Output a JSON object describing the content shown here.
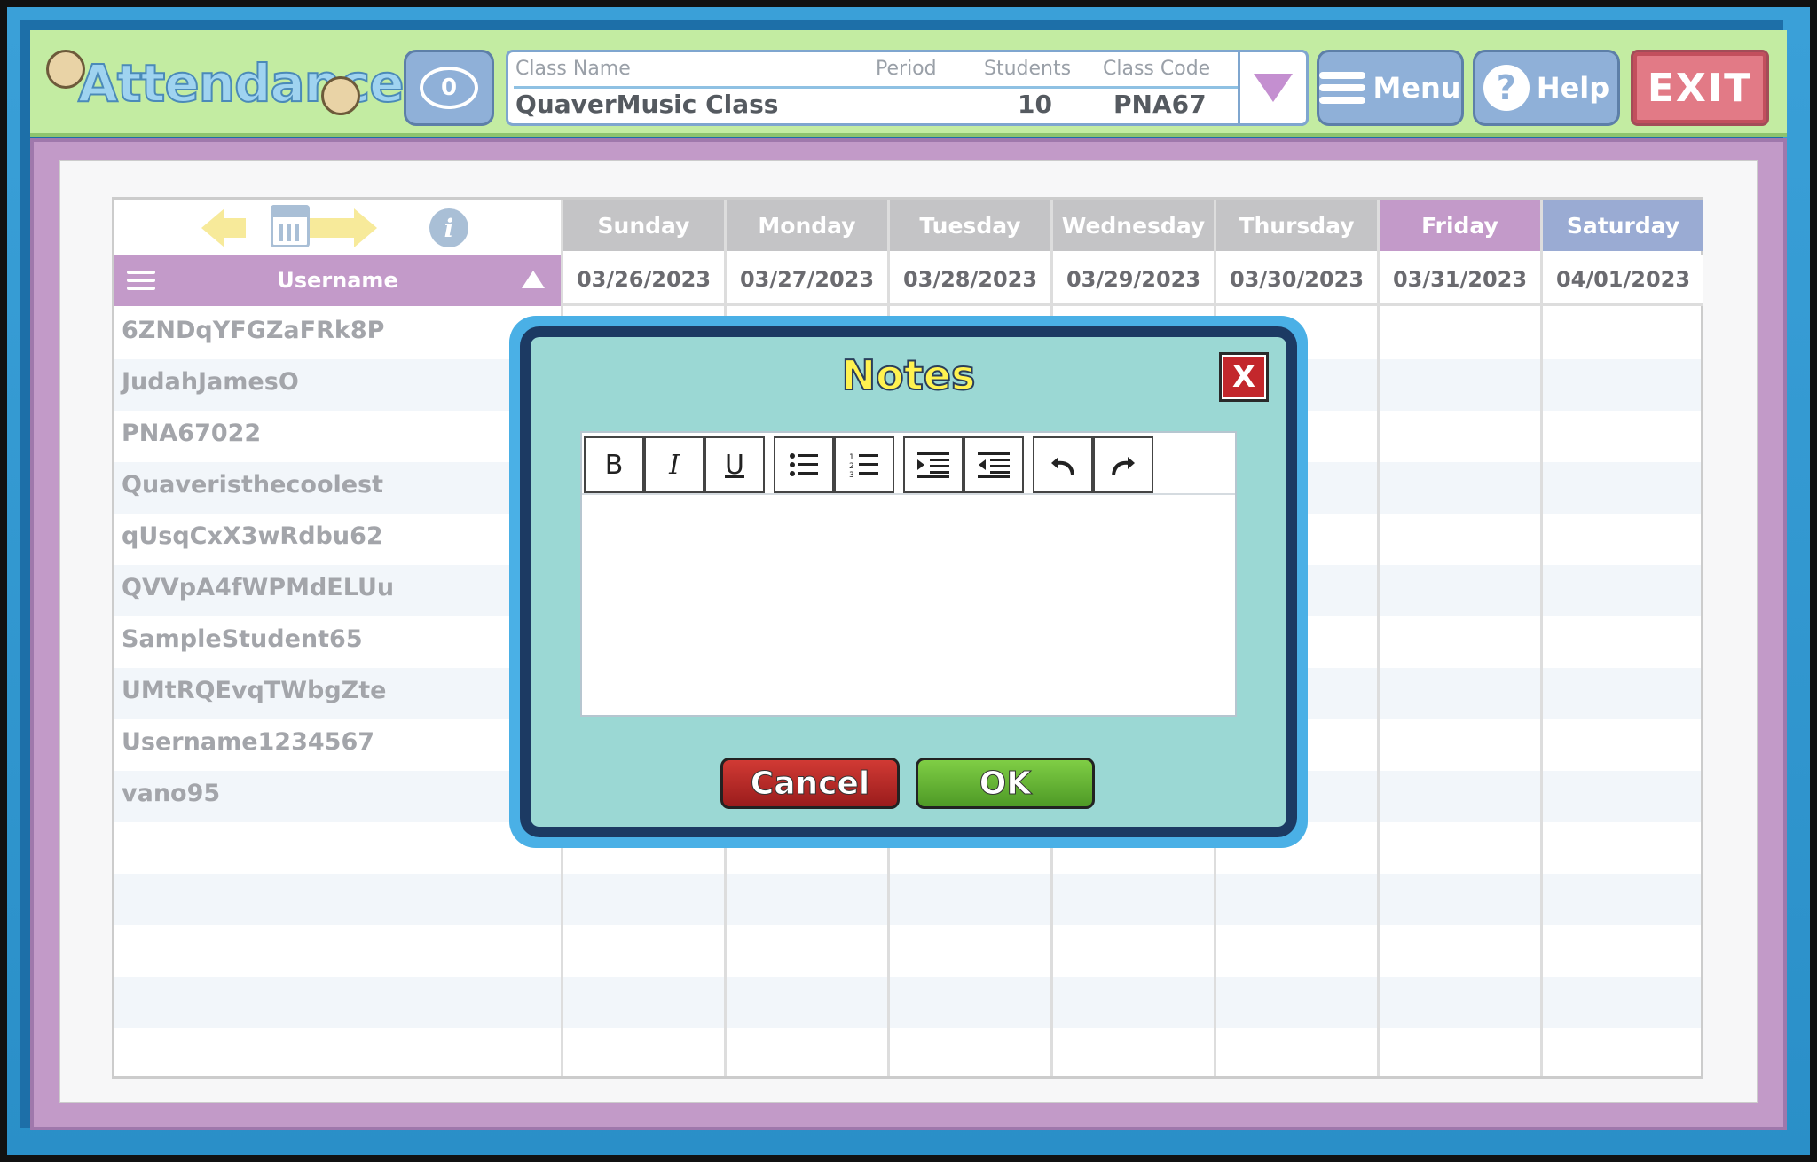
{
  "app": {
    "title": "Attendance"
  },
  "header": {
    "chat_count": "0",
    "class_panel": {
      "class_name_label": "Class Name",
      "period_label": "Period",
      "students_label": "Students",
      "class_code_label": "Class Code",
      "class_name": "QuaverMusic Class",
      "period": "",
      "students": "10",
      "class_code": "PNA67"
    },
    "menu_label": "Menu",
    "help_label": "Help",
    "exit_label": "EXIT"
  },
  "grid": {
    "username_header": "Username",
    "days": [
      {
        "name": "Sunday",
        "date": "03/26/2023",
        "color": "#c4c4c6"
      },
      {
        "name": "Monday",
        "date": "03/27/2023",
        "color": "#c4c4c6"
      },
      {
        "name": "Tuesday",
        "date": "03/28/2023",
        "color": "#c4c4c6"
      },
      {
        "name": "Wednesday",
        "date": "03/29/2023",
        "color": "#c4c4c6"
      },
      {
        "name": "Thursday",
        "date": "03/30/2023",
        "color": "#c4c4c6"
      },
      {
        "name": "Friday",
        "date": "03/31/2023",
        "color": "#c39ac9"
      },
      {
        "name": "Saturday",
        "date": "04/01/2023",
        "color": "#9aabd3"
      }
    ],
    "students": [
      "6ZNDqYFGZaFRk8P",
      "JudahJamesO",
      "PNA67022",
      "Quaveristhecoolest",
      "qUsqCxX3wRdbu62",
      "QVVpA4fWPMdELUu",
      "SampleStudent65",
      "UMtRQEvqTWbgZte",
      "Username1234567",
      "vano95"
    ]
  },
  "modal": {
    "title": "Notes",
    "close_label": "X",
    "toolbar": {
      "bold": "B",
      "italic": "I",
      "underline": "U"
    },
    "cancel_label": "Cancel",
    "ok_label": "OK"
  }
}
